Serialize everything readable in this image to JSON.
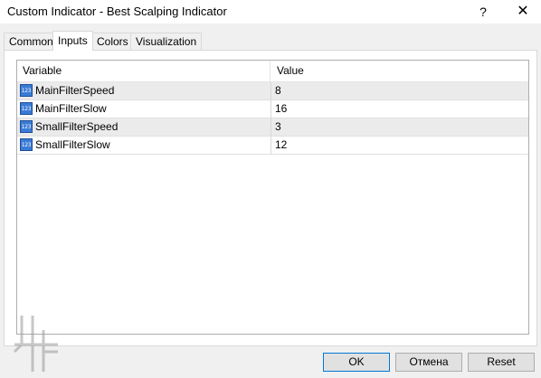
{
  "window": {
    "title": "Custom Indicator - Best Scalping Indicator",
    "help_glyph": "?",
    "close_glyph": "✕"
  },
  "tabs": [
    {
      "label": "Common",
      "active": false
    },
    {
      "label": "Inputs",
      "active": true
    },
    {
      "label": "Colors",
      "active": false
    },
    {
      "label": "Visualization",
      "active": false
    }
  ],
  "grid": {
    "headers": {
      "variable": "Variable",
      "value": "Value"
    },
    "icon_text": "123",
    "rows": [
      {
        "variable": "MainFilterSpeed",
        "value": "8"
      },
      {
        "variable": "MainFilterSlow",
        "value": "16"
      },
      {
        "variable": "SmallFilterSpeed",
        "value": "3"
      },
      {
        "variable": "SmallFilterSlow",
        "value": "12"
      }
    ]
  },
  "buttons": {
    "ok": "OK",
    "cancel": "Отмена",
    "reset": "Reset"
  },
  "icons": {
    "param": "integer-param-icon",
    "watermark": "logo-watermark"
  },
  "colors": {
    "accent": "#0078d7",
    "icon_blue": "#3a7bd5"
  }
}
